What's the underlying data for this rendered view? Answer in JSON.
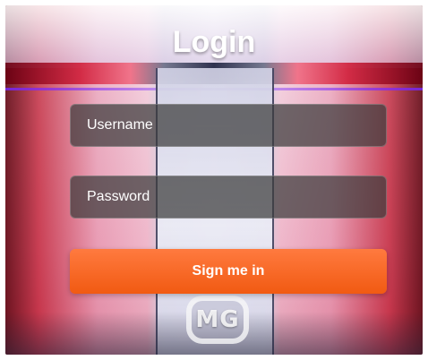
{
  "login": {
    "title": "Login",
    "username_placeholder": "Username",
    "password_placeholder": "Password",
    "sign_in_label": "Sign me in"
  },
  "background": {
    "badge_text": "MG"
  },
  "colors": {
    "button_gradient_start": "#ff7a3f",
    "button_gradient_end": "#f15a12",
    "input_background": "rgba(60,60,60,0.72)",
    "title_color": "#ffffff"
  }
}
